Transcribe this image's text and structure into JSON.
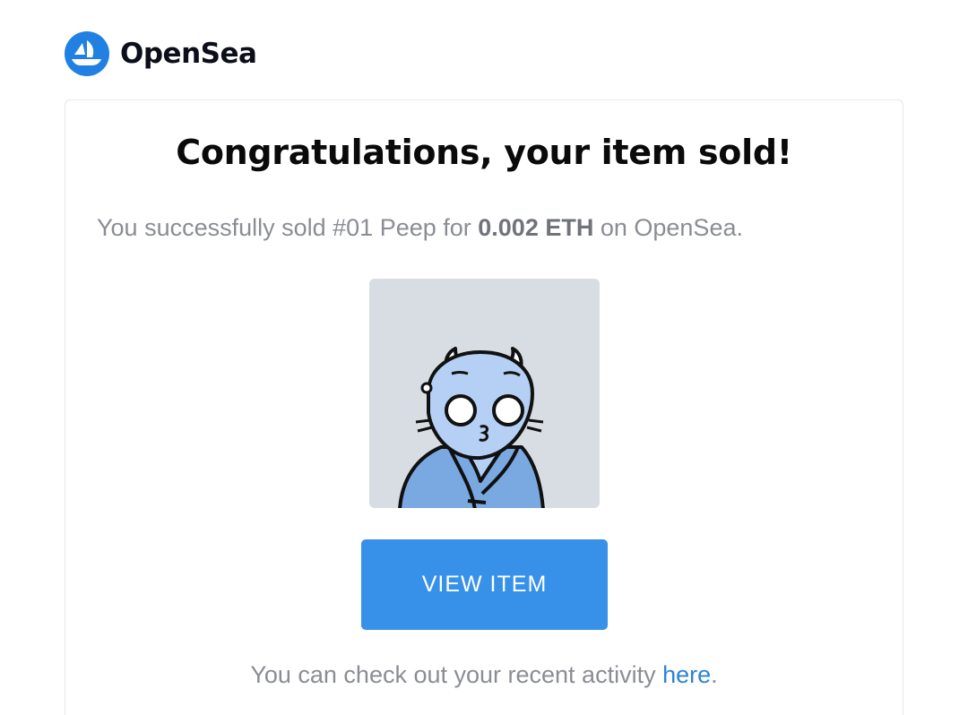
{
  "brand": {
    "name": "OpenSea",
    "logo_icon": "opensea-boat-icon",
    "logo_color": "#2081E2"
  },
  "email": {
    "headline": "Congratulations, your item sold!",
    "message_prefix": "You successfully sold #01 Peep for ",
    "price": "0.002 ETH",
    "message_suffix": " on OpenSea.",
    "item_image": "peep-cartoon-character",
    "view_button_label": "VIEW ITEM",
    "activity_prefix": "You can check out your recent activity ",
    "activity_link": "here",
    "activity_suffix": "."
  },
  "colors": {
    "button": "#3891e8",
    "link": "#2e83d4",
    "image_background": "#d8dde4"
  }
}
